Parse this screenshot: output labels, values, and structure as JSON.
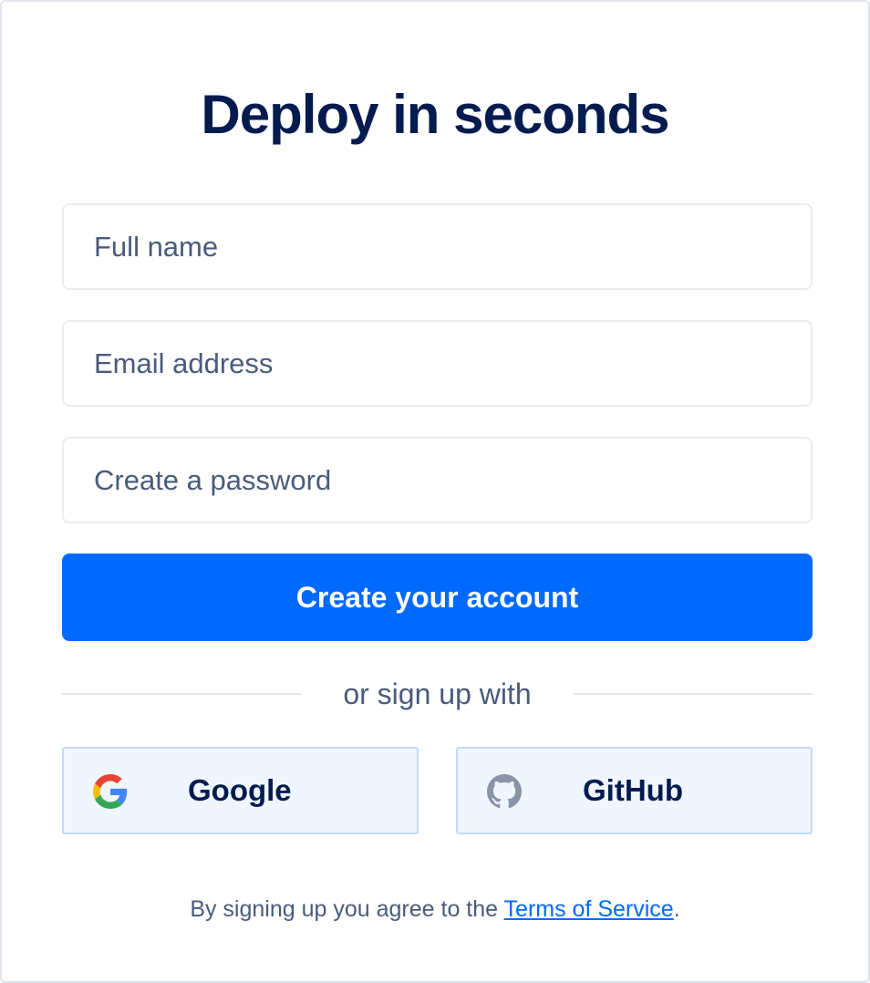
{
  "heading": "Deploy in seconds",
  "form": {
    "name_placeholder": "Full name",
    "email_placeholder": "Email address",
    "password_placeholder": "Create a password",
    "submit_label": "Create your account"
  },
  "divider": {
    "text": "or sign up with"
  },
  "social": {
    "google_label": "Google",
    "google_icon": "google-g-icon",
    "github_label": "GitHub",
    "github_icon": "github-octocat-icon"
  },
  "terms": {
    "prefix": "By signing up you agree to the ",
    "link_label": "Terms of Service",
    "suffix": "."
  },
  "colors": {
    "primary": "#0069ff",
    "heading": "#031b4e",
    "muted_text": "#4a5b7c",
    "social_bg": "#f0f6fd",
    "social_border": "#c3daf5"
  }
}
